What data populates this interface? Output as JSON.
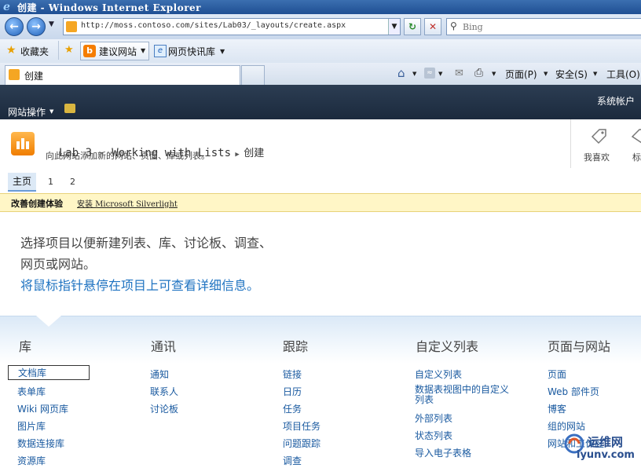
{
  "browser": {
    "window_title": "创建 - Windows Internet Explorer",
    "address_url": "http://moss.contoso.com/sites/Lab03/_layouts/create.aspx",
    "search_placeholder": "Bing",
    "favorites_label": "收藏夹",
    "suggested_sites_label": "建议网站",
    "web_slice_label": "网页快讯库",
    "tab_title": "创建",
    "commands": {
      "page": "页面(P)",
      "safety": "安全(S)",
      "tools": "工具(O)"
    }
  },
  "ribbon": {
    "site_actions": "网站操作",
    "system_account": "系统帐户"
  },
  "header": {
    "site_title": "Lab 3 - Working with Lists",
    "crumb_current": "创建",
    "description": "向此网站添加新的网站、页面、库或列表。",
    "i_like_it": "我喜欢",
    "tags": "标"
  },
  "nav": {
    "home": "主页",
    "items": [
      "1",
      "2"
    ]
  },
  "notice": {
    "bold": "改善创建体验",
    "link": "安装 Microsoft Silverlight"
  },
  "intro": {
    "line1": "选择项目以便新建列表、库、讨论板、调查、",
    "line2": "网页或网站。",
    "line3": "将鼠标指针悬停在项目上可查看详细信息。"
  },
  "categories": [
    {
      "heading": "库",
      "items": [
        "文档库",
        "表单库",
        "Wiki 网页库",
        "图片库",
        "数据连接库",
        "资源库"
      ]
    },
    {
      "heading": "通讯",
      "items": [
        "通知",
        "联系人",
        "讨论板"
      ]
    },
    {
      "heading": "跟踪",
      "items": [
        "链接",
        "日历",
        "任务",
        "项目任务",
        "问题跟踪",
        "调查"
      ]
    },
    {
      "heading": "自定义列表",
      "items": [
        "自定义列表",
        "数据表视图中的自定义列表",
        "外部列表",
        "状态列表",
        "导入电子表格"
      ]
    },
    {
      "heading": "页面与网站",
      "items": [
        "页面",
        "Web 部件页",
        "博客",
        "组的网站",
        "网站和工作区"
      ]
    }
  ],
  "watermark": {
    "text_top": "运维网",
    "text_bottom": "iyunv.com"
  },
  "colors": {
    "titlebar": "#1f4f93",
    "ribbon": "#1b2a3d",
    "link": "#1f73c1",
    "notice_bg": "#fff6c6"
  }
}
